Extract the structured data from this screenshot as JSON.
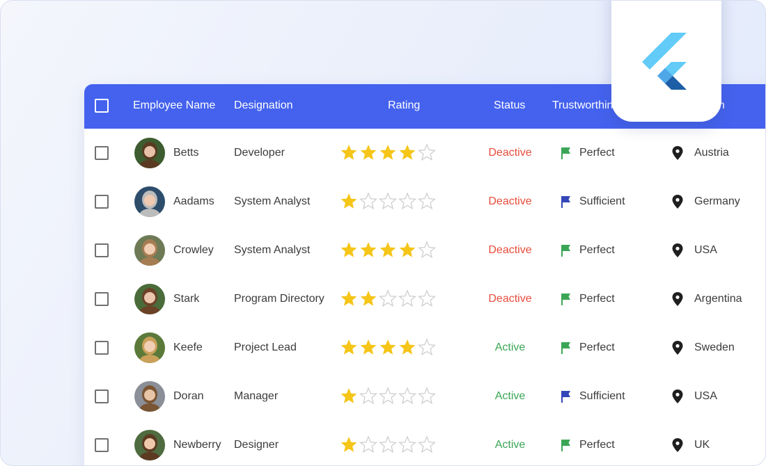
{
  "header": {
    "columns": [
      "Employee Name",
      "Designation",
      "Rating",
      "Status",
      "Trustworthin",
      "on"
    ]
  },
  "colors": {
    "header_bg": "#4462ee",
    "star_filled": "#f5c518",
    "star_empty": "#cfcfcf",
    "status_deactive": "#e74c3c",
    "status_active": "#3aa655",
    "flag_perfect": "#3aa655",
    "flag_sufficient": "#3347b8"
  },
  "rows": [
    {
      "name": "Betts",
      "designation": "Developer",
      "rating": 4,
      "status": "Deactive",
      "trust": "Perfect",
      "location": "Austria"
    },
    {
      "name": "Aadams",
      "designation": "System Analyst",
      "rating": 1,
      "status": "Deactive",
      "trust": "Sufficient",
      "location": "Germany"
    },
    {
      "name": "Crowley",
      "designation": "System Analyst",
      "rating": 4,
      "status": "Deactive",
      "trust": "Perfect",
      "location": "USA"
    },
    {
      "name": "Stark",
      "designation": "Program Directory",
      "rating": 2,
      "status": "Deactive",
      "trust": "Perfect",
      "location": "Argentina"
    },
    {
      "name": "Keefe",
      "designation": "Project Lead",
      "rating": 4,
      "status": "Active",
      "trust": "Perfect",
      "location": "Sweden"
    },
    {
      "name": "Doran",
      "designation": "Manager",
      "rating": 1,
      "status": "Active",
      "trust": "Sufficient",
      "location": "USA"
    },
    {
      "name": "Newberry",
      "designation": "Designer",
      "rating": 1,
      "status": "Active",
      "trust": "Perfect",
      "location": "UK"
    }
  ],
  "logo": {
    "icon": "flutter-logo-icon"
  }
}
